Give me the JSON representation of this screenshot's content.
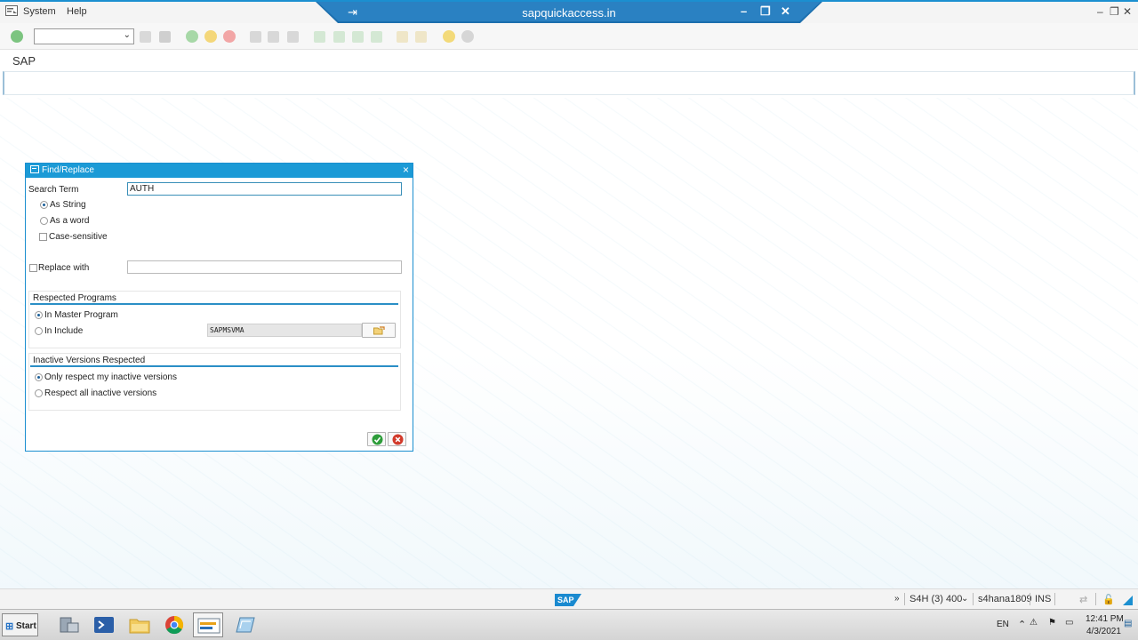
{
  "menubar": {
    "items": [
      "System",
      "Help"
    ],
    "window_title": "sapquickaccess.in"
  },
  "page": {
    "title": "SAP"
  },
  "dialog": {
    "title": "Find/Replace",
    "search_term_label": "Search Term",
    "search_term_value": "AUTH",
    "as_string_label": "As String",
    "as_word_label": "As a word",
    "case_sensitive_label": "Case-sensitive",
    "replace_with_label": "Replace with",
    "replace_with_value": "",
    "programs_section": {
      "title": "Respected Programs",
      "master_label": "In Master Program",
      "include_label": "In Include",
      "include_value": "SAPMSVMA"
    },
    "inactive_section": {
      "title": "Inactive Versions Respected",
      "only_mine_label": "Only respect my inactive versions",
      "all_label": "Respect all inactive versions"
    }
  },
  "statusbar": {
    "system": "S4H (3) 400",
    "server": "s4hana1809",
    "mode": "INS"
  },
  "taskbar": {
    "start_label": "Start",
    "language": "EN",
    "time": "12:41 PM",
    "date": "4/3/2021"
  },
  "colors": {
    "accent": "#1b9ad6",
    "ok_green": "#2e9d3a",
    "cancel_red": "#d23a2a"
  }
}
